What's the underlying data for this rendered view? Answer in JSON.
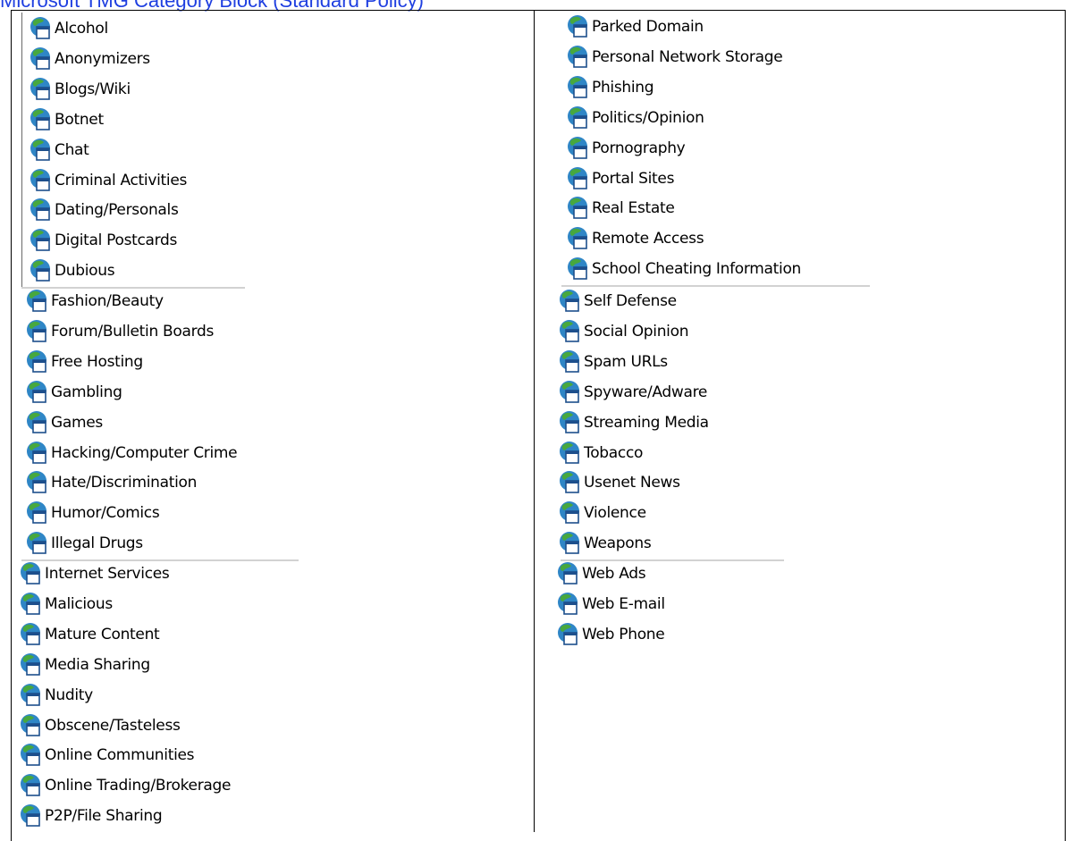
{
  "header": {
    "title": "Microsoft TMG Category Block (Standard Policy)"
  },
  "icon": {
    "name": "url-category-globe-icon",
    "colors": {
      "globe": "#2f86c6",
      "land": "#47a83e",
      "window_frame": "#1d4f8c"
    }
  },
  "columns": [
    {
      "groups": [
        {
          "items": [
            "Alcohol",
            "Anonymizers",
            "Blogs/Wiki",
            "Botnet",
            "Chat",
            "Criminal Activities",
            "Dating/Personals",
            "Digital Postcards",
            "Dubious"
          ]
        },
        {
          "items": [
            "Fashion/Beauty",
            "Forum/Bulletin Boards",
            "Free Hosting",
            "Gambling",
            "Games",
            "Hacking/Computer Crime",
            "Hate/Discrimination",
            "Humor/Comics",
            "Illegal Drugs"
          ]
        },
        {
          "items": [
            "Internet Services",
            "Malicious",
            "Mature Content",
            "Media Sharing",
            "Nudity",
            "Obscene/Tasteless",
            "Online Communities",
            "Online Trading/Brokerage",
            "P2P/File Sharing"
          ]
        }
      ]
    },
    {
      "groups": [
        {
          "items": [
            "Parked Domain",
            "Personal Network Storage",
            "Phishing",
            "Politics/Opinion",
            "Pornography",
            "Portal Sites",
            "Real Estate",
            "Remote Access",
            "School Cheating Information"
          ]
        },
        {
          "items": [
            "Self Defense",
            "Social Opinion",
            "Spam URLs",
            "Spyware/Adware",
            "Streaming Media",
            "Tobacco",
            "Usenet News",
            "Violence",
            "Weapons"
          ]
        },
        {
          "items": [
            "Web Ads",
            "Web E-mail",
            "Web Phone"
          ]
        }
      ]
    }
  ]
}
